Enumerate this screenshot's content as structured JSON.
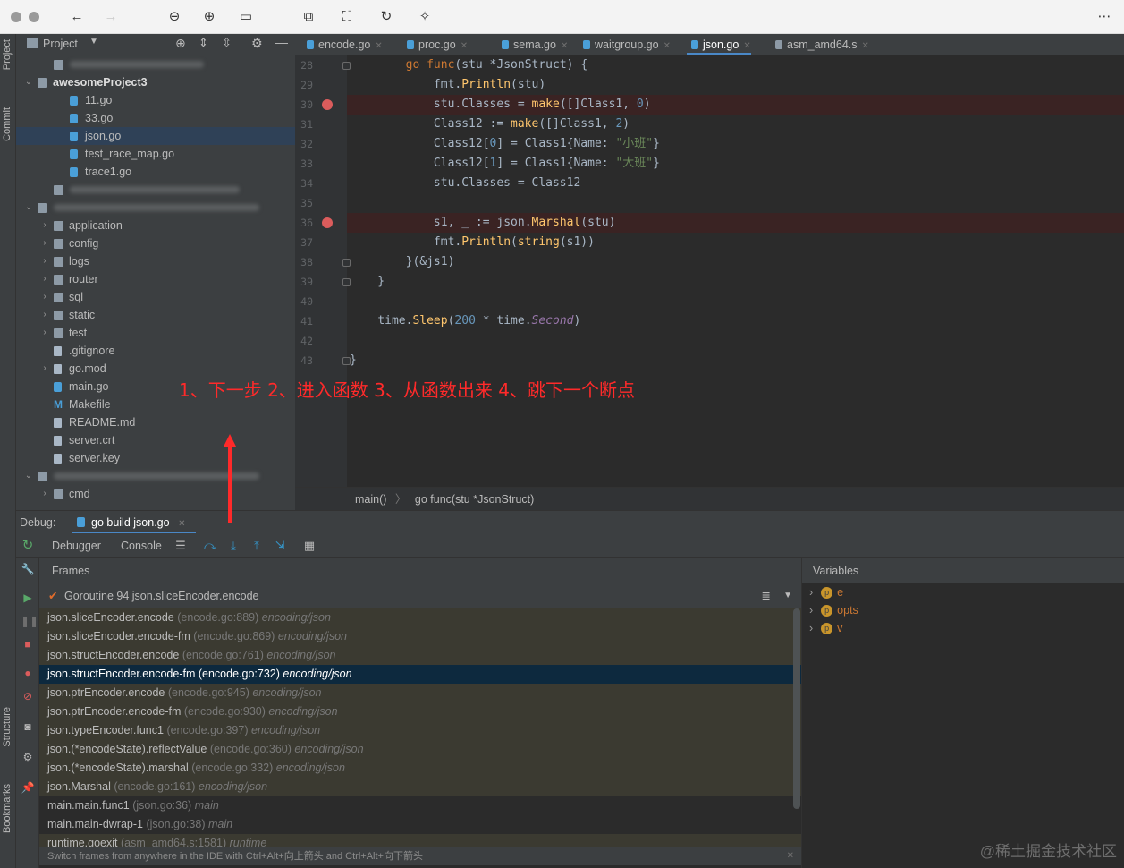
{
  "toolbar": {
    "more": "⋯"
  },
  "left_strip": {
    "project": "Project",
    "commit": "Commit",
    "structure": "Structure",
    "bookmarks": "Bookmarks"
  },
  "project_panel": {
    "title": "Project"
  },
  "tree": [
    {
      "label": "",
      "blur": true,
      "indent": 2,
      "arrow": "",
      "icon": "dir"
    },
    {
      "label": "awesomeProject3",
      "indent": 1,
      "arrow": "⌄",
      "icon": "dir",
      "bold": true
    },
    {
      "label": "11.go",
      "indent": 3,
      "arrow": "",
      "icon": "go"
    },
    {
      "label": "33.go",
      "indent": 3,
      "arrow": "",
      "icon": "go"
    },
    {
      "label": "json.go",
      "indent": 3,
      "arrow": "",
      "icon": "go",
      "selected": true
    },
    {
      "label": "test_race_map.go",
      "indent": 3,
      "arrow": "",
      "icon": "go"
    },
    {
      "label": "trace1.go",
      "indent": 3,
      "arrow": "",
      "icon": "go"
    },
    {
      "label": "",
      "blur": true,
      "indent": 2,
      "arrow": "",
      "icon": "dir"
    },
    {
      "label": "",
      "blur": true,
      "indent": 1,
      "arrow": "⌄",
      "icon": "dir"
    },
    {
      "label": "application",
      "indent": 2,
      "arrow": "›",
      "icon": "dir"
    },
    {
      "label": "config",
      "indent": 2,
      "arrow": "›",
      "icon": "dir"
    },
    {
      "label": "logs",
      "indent": 2,
      "arrow": "›",
      "icon": "dir"
    },
    {
      "label": "router",
      "indent": 2,
      "arrow": "›",
      "icon": "dir"
    },
    {
      "label": "sql",
      "indent": 2,
      "arrow": "›",
      "icon": "dir"
    },
    {
      "label": "static",
      "indent": 2,
      "arrow": "›",
      "icon": "dir"
    },
    {
      "label": "test",
      "indent": 2,
      "arrow": "›",
      "icon": "dir"
    },
    {
      "label": ".gitignore",
      "indent": 2,
      "arrow": "",
      "icon": "txt"
    },
    {
      "label": "go.mod",
      "indent": 2,
      "arrow": "›",
      "icon": "txt"
    },
    {
      "label": "main.go",
      "indent": 2,
      "arrow": "",
      "icon": "go"
    },
    {
      "label": "Makefile",
      "indent": 2,
      "arrow": "",
      "icon": "txt",
      "prefix": "M"
    },
    {
      "label": "README.md",
      "indent": 2,
      "arrow": "",
      "icon": "txt"
    },
    {
      "label": "server.crt",
      "indent": 2,
      "arrow": "",
      "icon": "txt"
    },
    {
      "label": "server.key",
      "indent": 2,
      "arrow": "",
      "icon": "txt"
    },
    {
      "label": "",
      "blur": true,
      "indent": 1,
      "arrow": "⌄",
      "icon": "dir"
    },
    {
      "label": "cmd",
      "indent": 2,
      "arrow": "›",
      "icon": "dir"
    }
  ],
  "tabs": [
    {
      "label": "encode.go",
      "active": false
    },
    {
      "label": "proc.go",
      "active": false
    },
    {
      "label": "sema.go",
      "active": false
    },
    {
      "label": "waitgroup.go",
      "active": false
    },
    {
      "label": "json.go",
      "active": true
    },
    {
      "label": "asm_amd64.s",
      "active": false
    }
  ],
  "code": [
    {
      "ln": "28",
      "html": "        <span class='kw'>go</span> <span class='kw'>func</span>(stu *<span class='ty'>JsonStruct</span>) {",
      "bp": false
    },
    {
      "ln": "29",
      "html": "            <span class='pk'>fmt</span>.<span class='fn'>Println</span>(stu)",
      "bp": false
    },
    {
      "ln": "30",
      "html": "            stu.Classes = <span class='bi'>make</span>([]<span class='ty'>Class1</span>, <span class='nu'>0</span>)",
      "bp": true
    },
    {
      "ln": "31",
      "html": "            Class12 := <span class='bi'>make</span>([]<span class='ty'>Class1</span>, <span class='nu'>2</span>)",
      "bp": false
    },
    {
      "ln": "32",
      "html": "            Class12[<span class='nu'>0</span>] = <span class='ty'>Class1</span>{Name: <span class='st'>\"小班\"</span>}",
      "bp": false
    },
    {
      "ln": "33",
      "html": "            Class12[<span class='nu'>1</span>] = <span class='ty'>Class1</span>{Name: <span class='st'>\"大班\"</span>}",
      "bp": false
    },
    {
      "ln": "34",
      "html": "            stu.Classes = Class12",
      "bp": false
    },
    {
      "ln": "35",
      "html": "",
      "bp": false
    },
    {
      "ln": "36",
      "html": "            s1, _ := <span class='pk'>json</span>.<span class='fn'>Marshal</span>(stu)",
      "bp": true
    },
    {
      "ln": "37",
      "html": "            <span class='pk'>fmt</span>.<span class='fn'>Println</span>(<span class='bi'>string</span>(s1))",
      "bp": false
    },
    {
      "ln": "38",
      "html": "        }(&amp;js1)",
      "bp": false
    },
    {
      "ln": "39",
      "html": "    }",
      "bp": false
    },
    {
      "ln": "40",
      "html": "",
      "bp": false
    },
    {
      "ln": "41",
      "html": "    <span class='pk'>time</span>.<span class='fn'>Sleep</span>(<span class='nu'>200</span> * <span class='pk'>time</span>.<span class='it'>Second</span>)",
      "bp": false
    },
    {
      "ln": "42",
      "html": "",
      "bp": false
    },
    {
      "ln": "43",
      "html": "}",
      "bp": false
    }
  ],
  "annotation": "1、下一步 2、进入函数 3、从函数出来 4、跳下一个断点",
  "breadcrumbs": [
    "main()",
    "go func(stu *JsonStruct)"
  ],
  "debug": {
    "label": "Debug:",
    "config": "go build json.go",
    "tabs": [
      "Debugger",
      "Console"
    ]
  },
  "frames_title": "Frames",
  "goroutine": "Goroutine 94 json.sliceEncoder.encode",
  "frames": [
    {
      "fn": "json.sliceEncoder.encode",
      "loc": "(encode.go:889)",
      "pkg": "encoding/json",
      "lib": true
    },
    {
      "fn": "json.sliceEncoder.encode-fm",
      "loc": "(encode.go:869)",
      "pkg": "encoding/json",
      "lib": true
    },
    {
      "fn": "json.structEncoder.encode",
      "loc": "(encode.go:761)",
      "pkg": "encoding/json",
      "lib": true
    },
    {
      "fn": "json.structEncoder.encode-fm",
      "loc": "(encode.go:732)",
      "pkg": "encoding/json",
      "lib": true,
      "selected": true
    },
    {
      "fn": "json.ptrEncoder.encode",
      "loc": "(encode.go:945)",
      "pkg": "encoding/json",
      "lib": true
    },
    {
      "fn": "json.ptrEncoder.encode-fm",
      "loc": "(encode.go:930)",
      "pkg": "encoding/json",
      "lib": true
    },
    {
      "fn": "json.typeEncoder.func1",
      "loc": "(encode.go:397)",
      "pkg": "encoding/json",
      "lib": true
    },
    {
      "fn": "json.(*encodeState).reflectValue",
      "loc": "(encode.go:360)",
      "pkg": "encoding/json",
      "lib": true
    },
    {
      "fn": "json.(*encodeState).marshal",
      "loc": "(encode.go:332)",
      "pkg": "encoding/json",
      "lib": true
    },
    {
      "fn": "json.Marshal",
      "loc": "(encode.go:161)",
      "pkg": "encoding/json",
      "lib": true
    },
    {
      "fn": "main.main.func1",
      "loc": "(json.go:36)",
      "pkg": "main",
      "lib": false
    },
    {
      "fn": "main.main-dwrap-1",
      "loc": "(json.go:38)",
      "pkg": "main",
      "lib": false
    },
    {
      "fn": "runtime.goexit",
      "loc": "(asm_amd64.s:1581)",
      "pkg": "runtime",
      "lib": true
    }
  ],
  "variables_title": "Variables",
  "variables": [
    "e",
    "opts",
    "v"
  ],
  "status": "Switch frames from anywhere in the IDE with Ctrl+Alt+向上箭头 and Ctrl+Alt+向下箭头",
  "watermark": "@稀土掘金技术社区"
}
